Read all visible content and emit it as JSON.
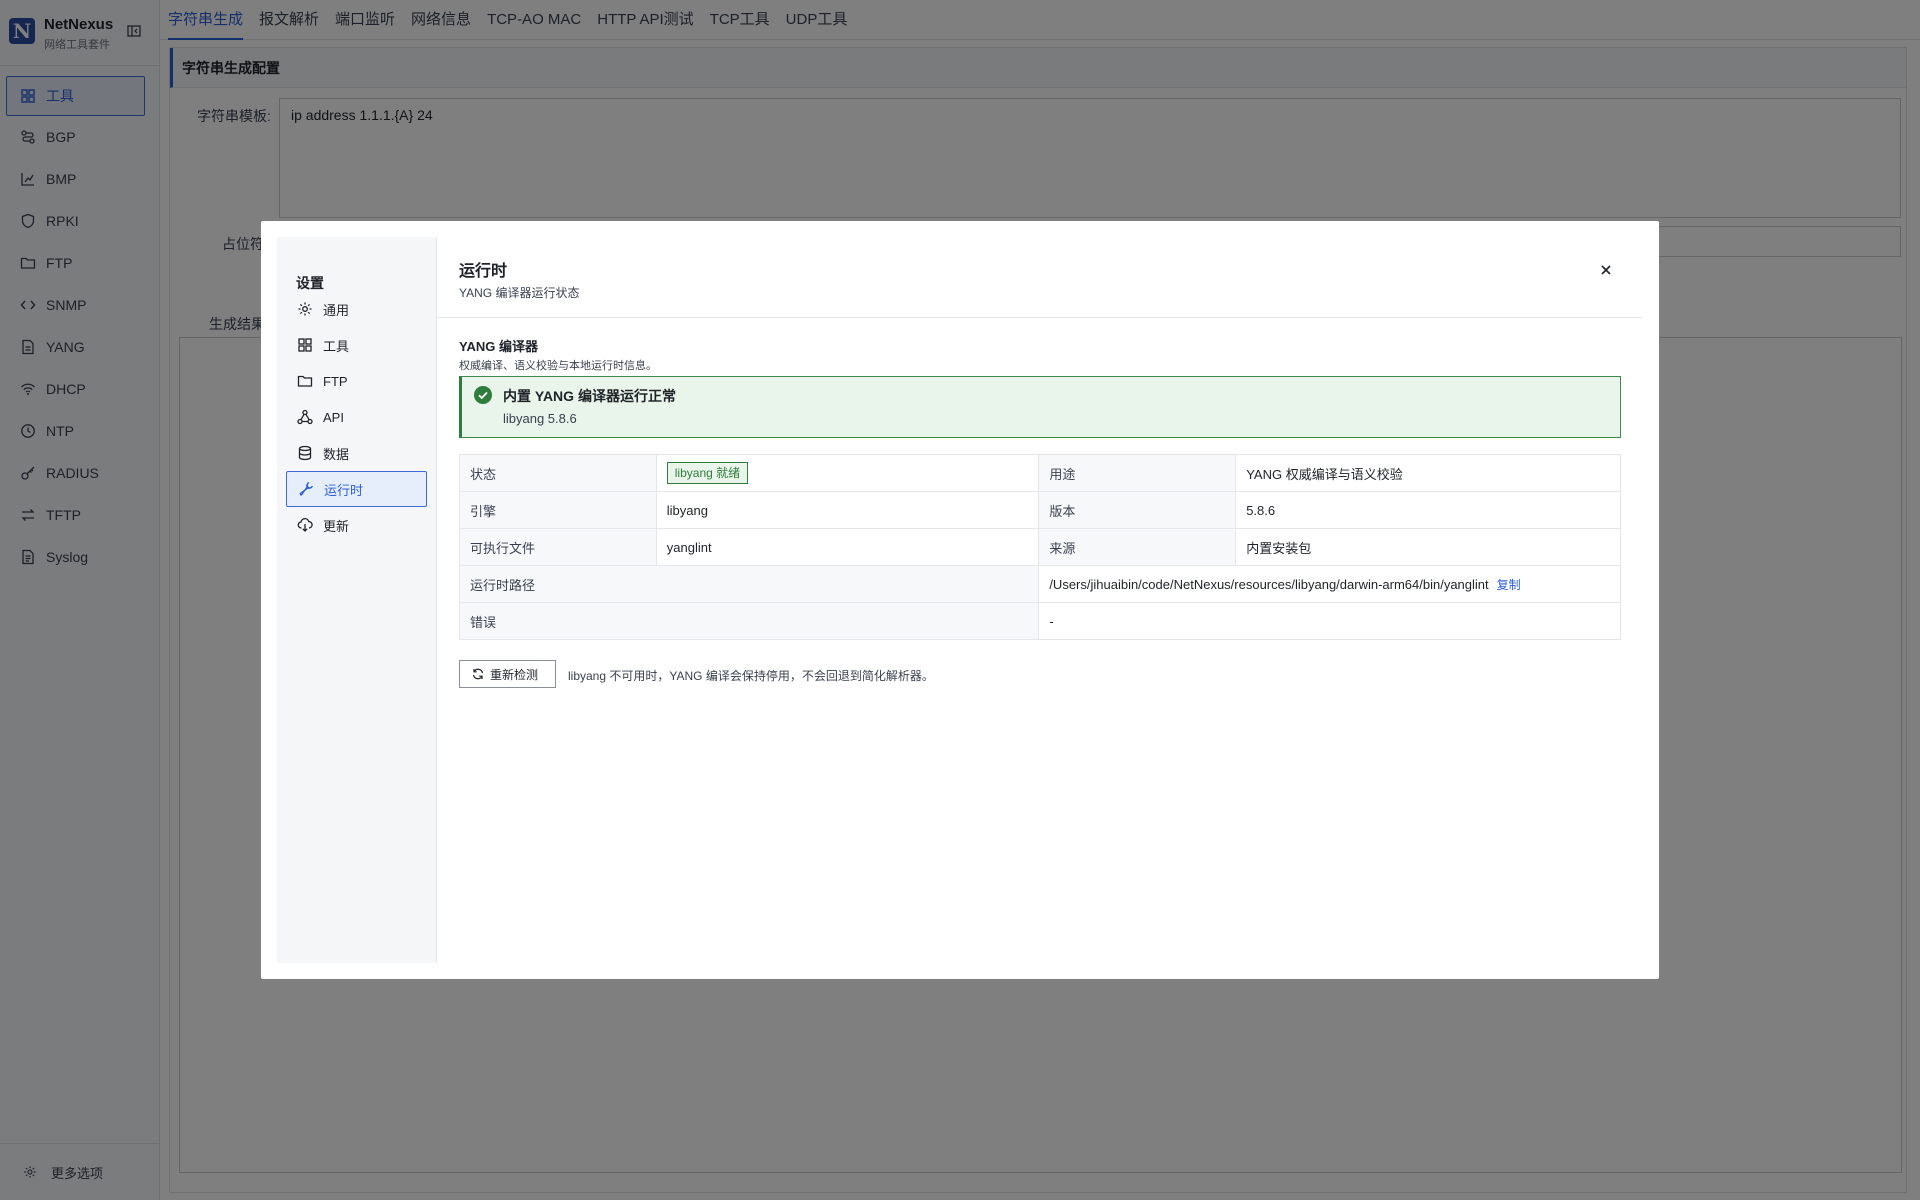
{
  "app": {
    "name": "NetNexus",
    "subtitle": "网络工具套件",
    "logo_letter": "N"
  },
  "sidebar": {
    "items": [
      {
        "label": "工具",
        "icon": "grid-icon",
        "active": true
      },
      {
        "label": "BGP",
        "icon": "route-icon"
      },
      {
        "label": "BMP",
        "icon": "chart-icon"
      },
      {
        "label": "RPKI",
        "icon": "shield-icon"
      },
      {
        "label": "FTP",
        "icon": "folder-icon"
      },
      {
        "label": "SNMP",
        "icon": "code-icon"
      },
      {
        "label": "YANG",
        "icon": "file-icon"
      },
      {
        "label": "DHCP",
        "icon": "wifi-icon"
      },
      {
        "label": "NTP",
        "icon": "clock-icon"
      },
      {
        "label": "RADIUS",
        "icon": "key-icon"
      },
      {
        "label": "TFTP",
        "icon": "transfer-icon"
      },
      {
        "label": "Syslog",
        "icon": "log-icon"
      }
    ],
    "footer_label": "更多选项"
  },
  "topbar": {
    "tabs": [
      "字符串生成",
      "报文解析",
      "端口监听",
      "网络信息",
      "TCP-AO MAC",
      "HTTP API测试",
      "TCP工具",
      "UDP工具"
    ],
    "active_tab": "字符串生成"
  },
  "main": {
    "panel_title": "字符串生成配置",
    "template_label": "字符串模板:",
    "template_value": "ip address 1.1.1.{A} 24",
    "placeholder_label": "占位符",
    "result_label": "生成结果"
  },
  "modal": {
    "sidebar_title": "设置",
    "nav": [
      {
        "label": "通用",
        "icon": "gear-icon"
      },
      {
        "label": "工具",
        "icon": "grid-icon"
      },
      {
        "label": "FTP",
        "icon": "folder-icon"
      },
      {
        "label": "API",
        "icon": "network-icon"
      },
      {
        "label": "数据",
        "icon": "database-icon"
      },
      {
        "label": "运行时",
        "icon": "wrench-icon",
        "active": true
      },
      {
        "label": "更新",
        "icon": "cloud-download-icon"
      }
    ],
    "title": "运行时",
    "subtitle": "YANG 编译器运行状态",
    "section_title": "YANG 编译器",
    "section_desc": "权威编译、语义校验与本地运行时信息。",
    "alert": {
      "title": "内置 YANG 编译器运行正常",
      "detail": "libyang 5.8.6",
      "color": "#2f7d3c"
    },
    "table": {
      "status_label": "状态",
      "status_value": "libyang 就绪",
      "purpose_label": "用途",
      "purpose_value": "YANG 权威编译与语义校验",
      "engine_label": "引擎",
      "engine_value": "libyang",
      "version_label": "版本",
      "version_value": "5.8.6",
      "exe_label": "可执行文件",
      "exe_value": "yanglint",
      "source_label": "来源",
      "source_value": "内置安装包",
      "path_label": "运行时路径",
      "path_value": "/Users/jihuaibin/code/NetNexus/resources/libyang/darwin-arm64/bin/yanglint",
      "copy_label": "复制",
      "error_label": "错误",
      "error_value": "-"
    },
    "recheck_label": "重新检测",
    "recheck_note": "libyang 不可用时，YANG 编译会保持停用，不会回退到简化解析器。"
  },
  "colors": {
    "accent": "#2b5fd9",
    "success": "#2f7d3c",
    "overlay": "rgba(0,0,0,0.5)"
  }
}
